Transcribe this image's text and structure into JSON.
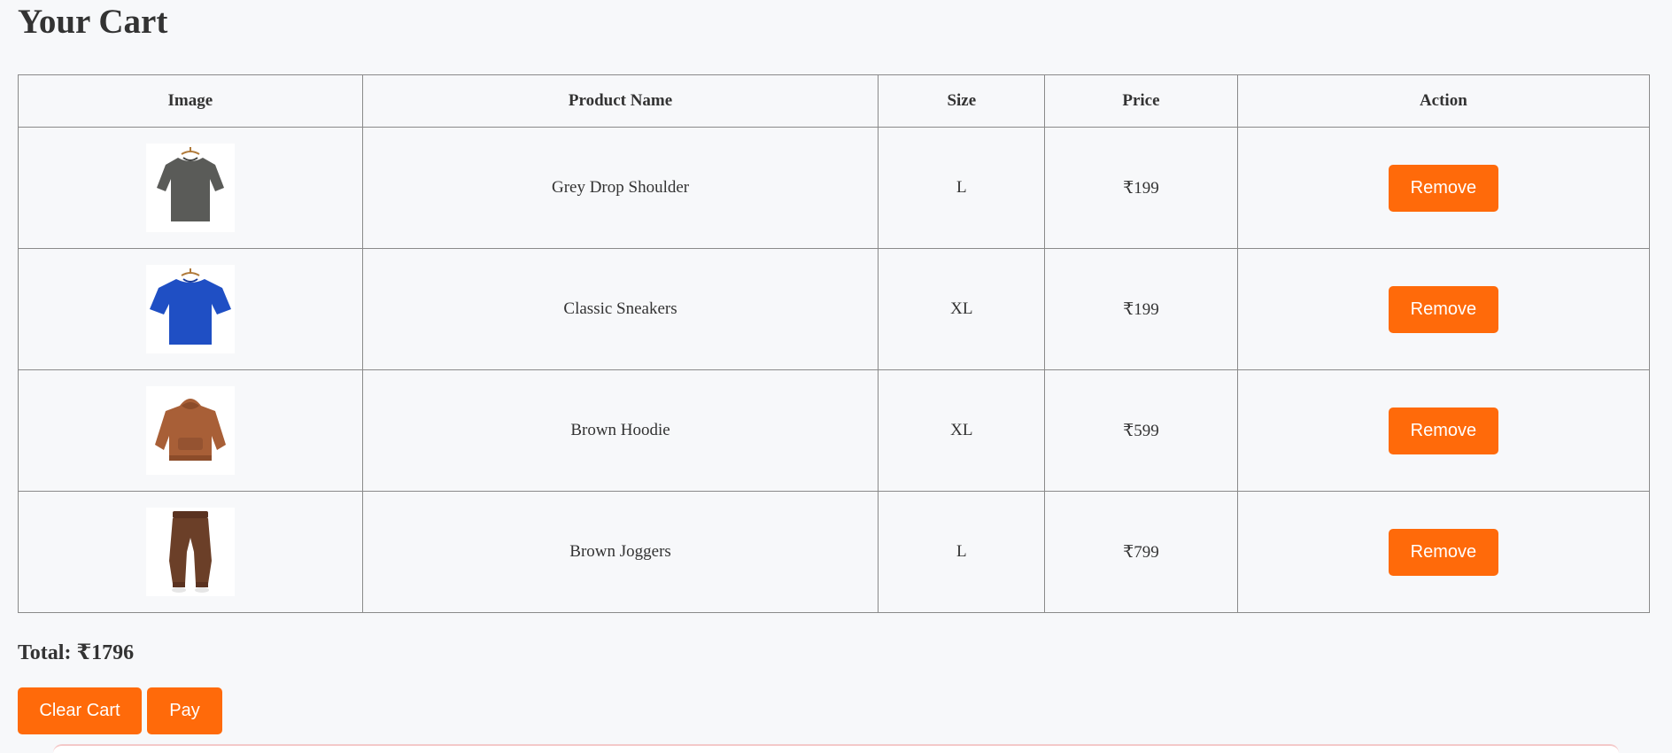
{
  "page_title": "Your Cart",
  "table": {
    "headers": [
      "Image",
      "Product Name",
      "Size",
      "Price",
      "Action"
    ],
    "rows": [
      {
        "image_icon": "grey-tshirt-icon",
        "name": "Grey Drop Shoulder",
        "size": "L",
        "price": "₹199",
        "action": "Remove"
      },
      {
        "image_icon": "blue-tshirt-icon",
        "name": "Classic Sneakers",
        "size": "XL",
        "price": "₹199",
        "action": "Remove"
      },
      {
        "image_icon": "brown-hoodie-icon",
        "name": "Brown Hoodie",
        "size": "XL",
        "price": "₹599",
        "action": "Remove"
      },
      {
        "image_icon": "brown-joggers-icon",
        "name": "Brown Joggers",
        "size": "L",
        "price": "₹799",
        "action": "Remove"
      }
    ]
  },
  "total_label": "Total: ₹1796",
  "buttons": {
    "clear_cart": "Clear Cart",
    "pay": "Pay"
  },
  "colors": {
    "accent": "#ff6a0a",
    "background": "#f7f8fa",
    "border": "#8a8a8a",
    "grey_shirt": "#5a5b58",
    "blue_shirt": "#1f4fc4",
    "hoodie": "#a85f37",
    "joggers": "#6b3f28"
  }
}
